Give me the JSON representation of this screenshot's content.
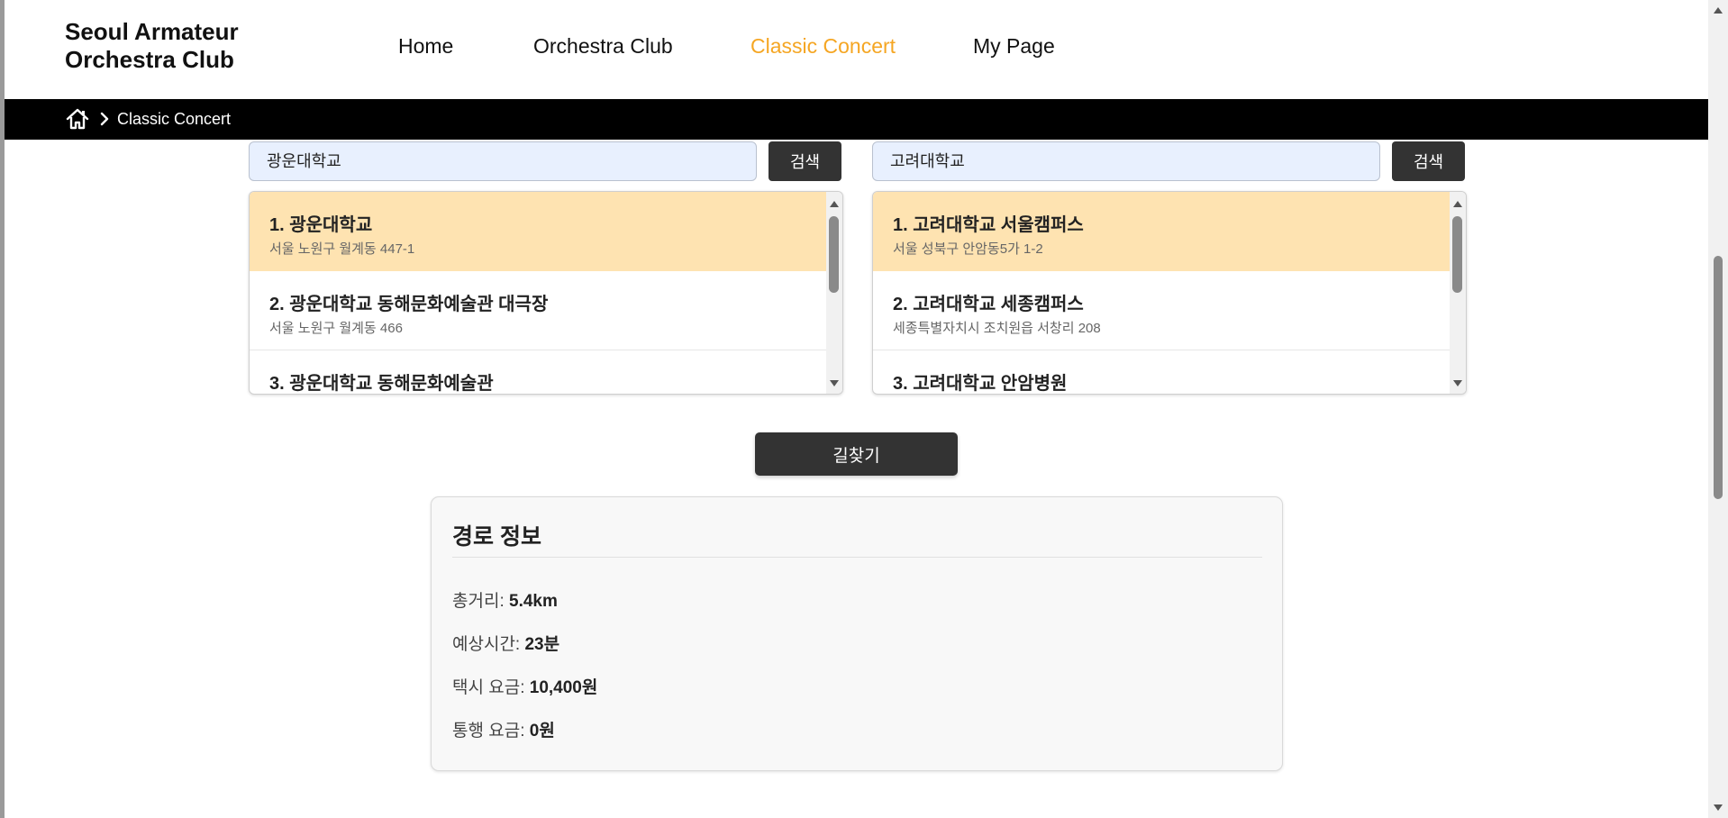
{
  "header": {
    "logo_line1": "Seoul Armateur",
    "logo_line2": "Orchestra Club",
    "nav": [
      {
        "label": "Home",
        "active": false
      },
      {
        "label": "Orchestra Club",
        "active": false
      },
      {
        "label": "Classic Concert",
        "active": true
      },
      {
        "label": "My Page",
        "active": false
      }
    ],
    "active_color": "#f5a623"
  },
  "breadcrumb": {
    "home_icon": "home-icon",
    "separator_icon": "chevron-right-icon",
    "current": "Classic Concert"
  },
  "origin": {
    "query": "광운대학교",
    "search_label": "검색",
    "results": [
      {
        "name": "1. 광운대학교",
        "address": "서울 노원구 월계동 447-1",
        "selected": true
      },
      {
        "name": "2. 광운대학교 동해문화예술관 대극장",
        "address": "서울 노원구 월계동 466",
        "selected": false
      },
      {
        "name": "3. 광운대학교 동해문화예술관",
        "address": "",
        "selected": false
      }
    ]
  },
  "destination": {
    "query": "고려대학교",
    "search_label": "검색",
    "results": [
      {
        "name": "1. 고려대학교 서울캠퍼스",
        "address": "서울 성북구 안암동5가 1-2",
        "selected": true
      },
      {
        "name": "2. 고려대학교 세종캠퍼스",
        "address": "세종특별자치시 조치원읍 서창리 208",
        "selected": false
      },
      {
        "name": "3. 고려대학교 안암병원",
        "address": "",
        "selected": false
      }
    ]
  },
  "route_button_label": "길찾기",
  "route_info": {
    "title": "경로 정보",
    "rows": [
      {
        "label": "총거리: ",
        "value": "5.4km"
      },
      {
        "label": "예상시간: ",
        "value": "23분"
      },
      {
        "label": "택시 요금: ",
        "value": "10,400원"
      },
      {
        "label": "통행 요금: ",
        "value": "0원"
      }
    ]
  },
  "colors": {
    "selected_result_bg": "#fee3b1",
    "input_bg": "#e8f0fe",
    "button_bg": "#333333",
    "breadcrumb_bg": "#000000"
  }
}
